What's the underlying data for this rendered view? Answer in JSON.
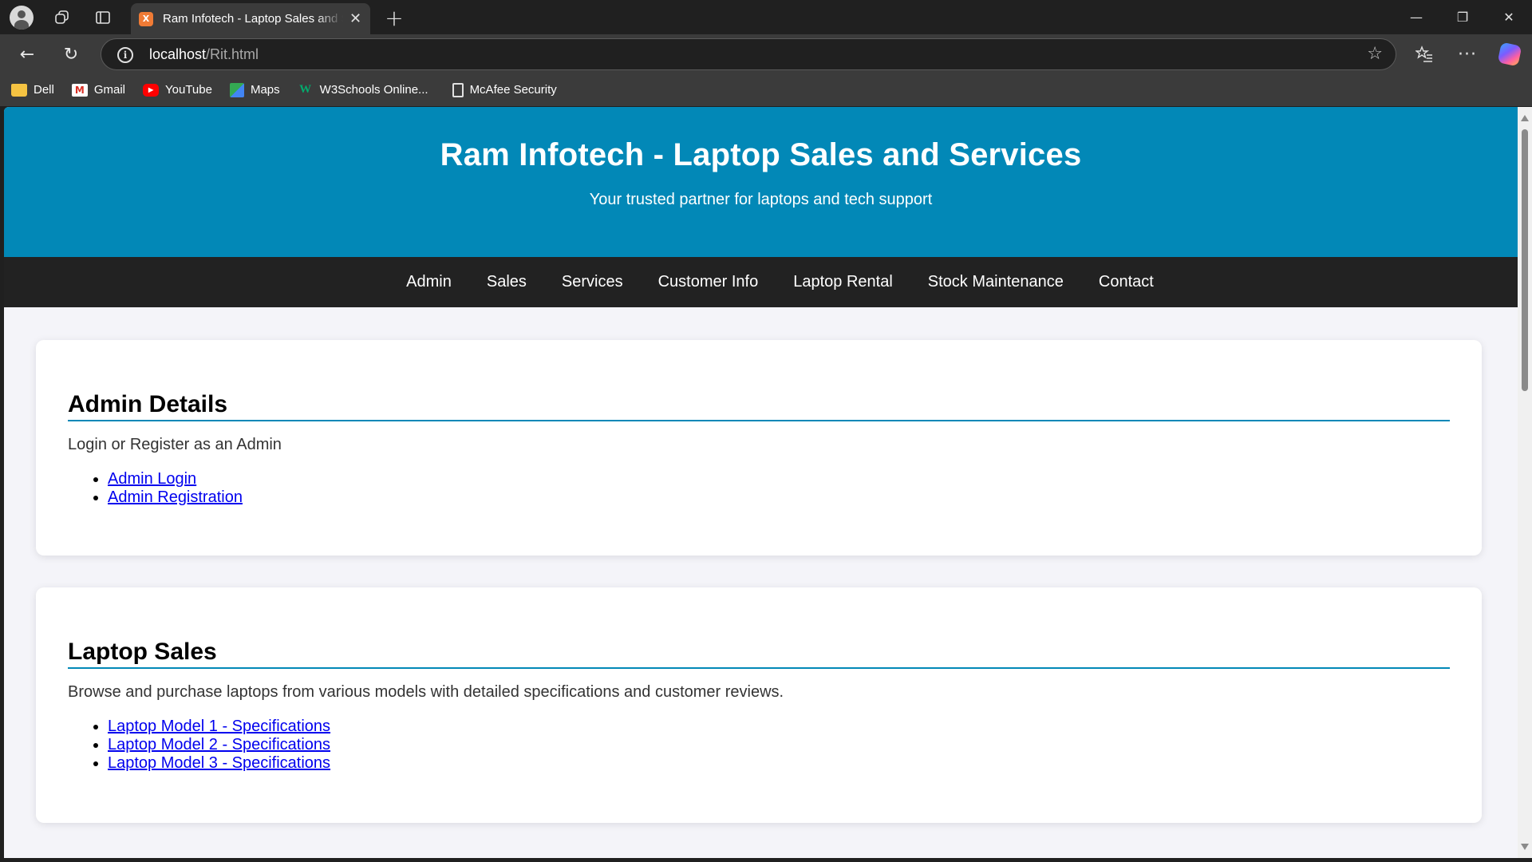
{
  "browser": {
    "tab_title": "Ram Infotech - Laptop Sales and Services",
    "favicon_text": "X",
    "url_host": "localhost",
    "url_path": "/Rit.html",
    "bookmarks": [
      {
        "label": "Dell",
        "icon": "folder-icon"
      },
      {
        "label": "Gmail",
        "icon": "gmail-icon"
      },
      {
        "label": "YouTube",
        "icon": "youtube-icon"
      },
      {
        "label": "Maps",
        "icon": "maps-icon"
      },
      {
        "label": "W3Schools Online...",
        "icon": "w3schools-icon"
      },
      {
        "label": "McAfee Security",
        "icon": "page-icon"
      }
    ]
  },
  "site": {
    "title": "Ram Infotech - Laptop Sales and Services",
    "tagline": "Your trusted partner for laptops and tech support",
    "nav": [
      "Admin",
      "Sales",
      "Services",
      "Customer Info",
      "Laptop Rental",
      "Stock Maintenance",
      "Contact"
    ],
    "accent_color": "#0288b7",
    "nav_bg_color": "#222222"
  },
  "sections": {
    "admin": {
      "heading": "Admin Details",
      "text": "Login or Register as an Admin",
      "links": [
        "Admin Login",
        "Admin Registration"
      ]
    },
    "sales": {
      "heading": "Laptop Sales",
      "text": "Browse and purchase laptops from various models with detailed specifications and customer reviews.",
      "links": [
        "Laptop Model 1 - Specifications",
        "Laptop Model 2 - Specifications",
        "Laptop Model 3 - Specifications"
      ]
    }
  }
}
